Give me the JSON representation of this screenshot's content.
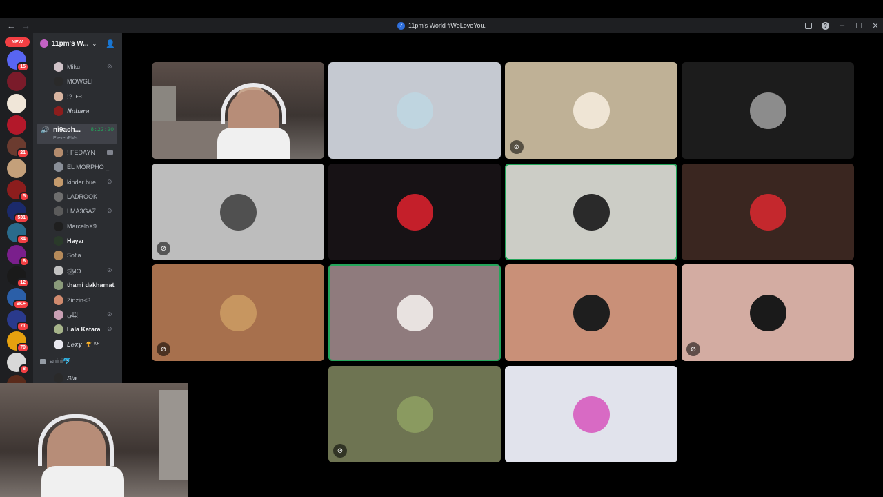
{
  "window": {
    "title": "11pm's World #WeLoveYou.",
    "back": "←",
    "forward": "→",
    "controls": {
      "inbox": "inbox-icon",
      "help": "?",
      "minimize": "–",
      "maximize": "☐",
      "close": "✕"
    }
  },
  "rail": {
    "new_label": "NEW",
    "servers": [
      {
        "badge": "15",
        "color": "#5865f2"
      },
      {
        "badge": "",
        "color": "#7a1b2a"
      },
      {
        "badge": "",
        "color": "#f0e6d8"
      },
      {
        "badge": "",
        "color": "#b3182a"
      },
      {
        "badge": "21",
        "color": "#6b3b2f"
      },
      {
        "badge": "",
        "color": "#c4a07a"
      },
      {
        "badge": "5",
        "color": "#8c1d1d"
      },
      {
        "badge": "531",
        "color": "#1b2a6b"
      },
      {
        "badge": "34",
        "color": "#2a6b8c"
      },
      {
        "badge": "6",
        "color": "#7a1f8c"
      },
      {
        "badge": "12",
        "color": "#1a1a1a"
      },
      {
        "badge": "9K+",
        "color": "#2b5fa8"
      },
      {
        "badge": "71",
        "color": "#2a3a8c"
      },
      {
        "badge": "70",
        "color": "#e6a10f"
      },
      {
        "badge": "8",
        "color": "#d8d8d8"
      },
      {
        "badge": "",
        "color": "#5a2a1a"
      }
    ]
  },
  "sidebar": {
    "guild_name": "11pm's W...",
    "self": {
      "name": "ni9ach...",
      "timer": "8:22:20",
      "sub": "ElevenPMs"
    },
    "members": [
      {
        "name": "Miku",
        "tag": "",
        "muted": true,
        "bold": false,
        "color": "#cfc2c8"
      },
      {
        "name": "MOWGLI",
        "tag": "",
        "muted": false,
        "bold": false,
        "color": "#2a2a2a"
      },
      {
        "name": "!?",
        "tag": "FR",
        "muted": false,
        "bold": false,
        "color": "#d8b4a0"
      },
      {
        "name": "𝑵𝒐𝒃𝒂𝒓𝒂",
        "tag": "",
        "muted": false,
        "bold": false,
        "color": "#8c1d1d"
      },
      {
        "name": "! FEDAYN",
        "tag": "",
        "muted": false,
        "bold": false,
        "color": "#b38b6d",
        "camera": true
      },
      {
        "name": "EL MORPHO _",
        "tag": "",
        "muted": false,
        "bold": false,
        "color": "#8a8f98"
      },
      {
        "name": "kinder bue...",
        "tag": "",
        "muted": true,
        "bold": false,
        "color": "#c49a6c"
      },
      {
        "name": "LADROOK",
        "tag": "",
        "muted": false,
        "bold": false,
        "color": "#6e6e6e"
      },
      {
        "name": "LMA3GAZ",
        "tag": "",
        "muted": true,
        "bold": false,
        "color": "#5b5b5b"
      },
      {
        "name": "MarceloX9",
        "tag": "",
        "muted": false,
        "bold": false,
        "color": "#1f1f1f"
      },
      {
        "name": "Hayar",
        "tag": "",
        "muted": false,
        "bold": true,
        "color": "#2a3a2a"
      },
      {
        "name": "Sofia",
        "tag": "",
        "muted": false,
        "bold": false,
        "color": "#b58a5a"
      },
      {
        "name": "S꙰MO",
        "tag": "",
        "muted": true,
        "bold": false,
        "color": "#c2c2c2"
      },
      {
        "name": "thami dakhamat",
        "tag": "",
        "muted": false,
        "bold": true,
        "color": "#8a9a7a"
      },
      {
        "name": "Zinzin<3",
        "tag": "",
        "muted": false,
        "bold": false,
        "color": "#d08a6e"
      },
      {
        "name": "لِيْلِي",
        "tag": "",
        "muted": true,
        "bold": false,
        "color": "#c9a0b4"
      },
      {
        "name": "Lala Katara",
        "tag": "",
        "muted": true,
        "bold": true,
        "color": "#a6b48a"
      },
      {
        "name": "𝑳𝒆𝒙𝒚",
        "tag": "🏆 ᵀᴼᴾ",
        "muted": false,
        "bold": false,
        "color": "#e8e8ef"
      }
    ],
    "locked_channel": "anini🐬",
    "last_member": {
      "name": "𝑺𝒊𝒂",
      "color": "#2a2a2a"
    }
  },
  "stage": {
    "tiles": [
      {
        "type": "camera",
        "speaking": false,
        "muted": false,
        "bg": "#4a403c",
        "avatar": ""
      },
      {
        "type": "avatar",
        "speaking": false,
        "muted": false,
        "bg": "#c5c9d1",
        "avatar": "#bfd5e0"
      },
      {
        "type": "avatar",
        "speaking": false,
        "muted": true,
        "bg": "#bfb196",
        "avatar": "#efe5d5"
      },
      {
        "type": "avatar",
        "speaking": false,
        "muted": false,
        "bg": "#1c1c1c",
        "avatar": "#8c8c8c"
      },
      {
        "type": "avatar",
        "speaking": false,
        "muted": true,
        "bg": "#bdbdbd",
        "avatar": "#505050"
      },
      {
        "type": "avatar",
        "speaking": false,
        "muted": false,
        "bg": "#171215",
        "avatar": "#c41f2a"
      },
      {
        "type": "avatar",
        "speaking": true,
        "muted": false,
        "bg": "#cccdc6",
        "avatar": "#2a2a2a"
      },
      {
        "type": "avatar",
        "speaking": false,
        "muted": false,
        "bg": "#3a2620",
        "avatar": "#c4282d"
      },
      {
        "type": "avatar",
        "speaking": false,
        "muted": true,
        "bg": "#a7704d",
        "avatar": "#c79660"
      },
      {
        "type": "avatar",
        "speaking": true,
        "muted": false,
        "bg": "#8f7b7d",
        "avatar": "#e8e2e0"
      },
      {
        "type": "avatar",
        "speaking": false,
        "muted": false,
        "bg": "#c99078",
        "avatar": "#1e1e1e"
      },
      {
        "type": "avatar",
        "speaking": false,
        "muted": true,
        "bg": "#d3aca2",
        "avatar": "#1a1a1a"
      },
      {
        "type": "avatar",
        "speaking": false,
        "muted": true,
        "bg": "#6e7452",
        "avatar": "#8a9a60"
      },
      {
        "type": "avatar",
        "speaking": false,
        "muted": false,
        "bg": "#e1e3ec",
        "avatar": "#d86ac4"
      }
    ]
  }
}
